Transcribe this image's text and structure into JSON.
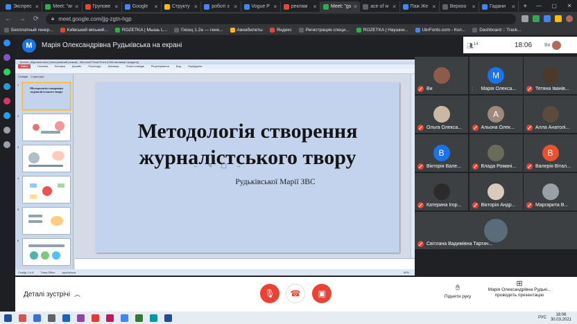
{
  "browser": {
    "tabs": [
      {
        "label": "Экспрес",
        "color": "#4285f4",
        "active": false
      },
      {
        "label": "Meet: \"ar",
        "color": "#34a853",
        "active": false
      },
      {
        "label": "Групове",
        "color": "#ea4335",
        "active": false
      },
      {
        "label": "Google",
        "color": "#4285f4",
        "active": false
      },
      {
        "label": "Структу",
        "color": "#fbbc04",
        "active": false
      },
      {
        "label": "роботі з",
        "color": "#4285f4",
        "active": false
      },
      {
        "label": "Vogue Р",
        "color": "#4285f4",
        "active": false
      },
      {
        "label": "реклам",
        "color": "#ea4335",
        "active": false
      },
      {
        "label": "Meet: \"gs",
        "color": "#34a853",
        "active": true
      },
      {
        "label": "ace of w",
        "color": "#5f6368",
        "active": false
      },
      {
        "label": "Паж Же",
        "color": "#4285f4",
        "active": false
      },
      {
        "label": "Верхоо",
        "color": "#5f6368",
        "active": false
      },
      {
        "label": "Гадани",
        "color": "#4285f4",
        "active": false
      }
    ],
    "url": "meet.google.com/jjg-zgtn-hgp",
    "bookmarks": [
      {
        "label": "Бесплатный генер...",
        "color": "#5f6368"
      },
      {
        "label": "Київський міський...",
        "color": "#ea4335"
      },
      {
        "label": "ROZETKA | Мышь L...",
        "color": "#34a853"
      },
      {
        "label": "Гисец 1.2а — гене...",
        "color": "#5f6368"
      },
      {
        "label": "Авиабилеты",
        "color": "#fbbc04"
      },
      {
        "label": "Яндекс",
        "color": "#ea4335"
      },
      {
        "label": "Регистрация специ...",
        "color": "#5f6368"
      },
      {
        "label": "ROZETKA | Наушни...",
        "color": "#34a853"
      },
      {
        "label": "UkrFonts.com - Кол...",
        "color": "#4285f4"
      },
      {
        "label": "Dashboard :: Track...",
        "color": "#5f6368"
      }
    ]
  },
  "meet": {
    "presenter_initial": "M",
    "presenter_title": "Марія Олександрівна Рудьківська на екрані",
    "participants_count": "14",
    "clock": "18:06",
    "me_label": "Ви",
    "details_label": "Деталі зустрічі",
    "raise_hand": "Підняти руку",
    "presenting": "Марія Олександрівна Рудькі... проводить презентацію"
  },
  "ppt": {
    "window_title": "Тренінг_Журналістика [Ілюстрований режим] - Microsoft PowerPoint (Сбій активації продукту)",
    "menu": [
      "Файл",
      "Головна",
      "Вставка",
      "Дизайн",
      "Переходи",
      "Анімація",
      "Показ слайдів",
      "Рецензування",
      "Вид",
      "Надбудова"
    ],
    "panel_tabs": [
      "Слайди",
      "Структура"
    ],
    "slide_title": "Методологія створення журналістського твору",
    "slide_subtitle": "Рудьківської Марії ЗВС",
    "thumb1_title": "Методологія створення журналістського твору",
    "status": [
      "Слайд 1 із 8",
      "Тема Office",
      "українська"
    ],
    "zoom": "80%",
    "thumb_numbers": [
      "1",
      "2",
      "3",
      "4",
      "5",
      "6"
    ]
  },
  "participants": [
    {
      "name": "Ви",
      "initial": "",
      "color": "#8d5b4c",
      "mic": "off"
    },
    {
      "name": "Марія Олекса...",
      "initial": "M",
      "color": "#1a73e8",
      "mic": "on"
    },
    {
      "name": "Тетяна Іванів...",
      "initial": "",
      "color": "#4b3a2a",
      "mic": "off"
    },
    {
      "name": "Ольга Олекса...",
      "initial": "",
      "color": "#c9b9a4",
      "mic": "off"
    },
    {
      "name": "Альона Олек...",
      "initial": "А",
      "color": "#a1887f",
      "mic": "off"
    },
    {
      "name": "Алла Анатолі...",
      "initial": "",
      "color": "#5c4b3b",
      "mic": "off"
    },
    {
      "name": "Вікторія Вале...",
      "initial": "В",
      "color": "#1a73e8",
      "mic": "off"
    },
    {
      "name": "Влада Романі...",
      "initial": "",
      "color": "#6b6b5a",
      "mic": "off"
    },
    {
      "name": "Валерія Вітал...",
      "initial": "В",
      "color": "#e8522f",
      "mic": "off"
    },
    {
      "name": "Катерина Ігор...",
      "initial": "",
      "color": "#2b2b2b",
      "mic": "off"
    },
    {
      "name": "Вікторія Андр...",
      "initial": "",
      "color": "#d9cbbb",
      "mic": "off"
    },
    {
      "name": "Маргарита В...",
      "initial": "",
      "color": "#9aa0a6",
      "mic": "off"
    },
    {
      "name": "Світлана Вадимівна Тартач...",
      "initial": "",
      "color": "#5a6b7a",
      "mic": "off"
    }
  ],
  "taskbar": {
    "apps": [
      "#d9534f",
      "#3b6fd8",
      "#5f6368",
      "#1565c0",
      "#8e44ad",
      "#e53935",
      "#c2185b",
      "#4285f4",
      "#2e7d32",
      "#0097a7",
      "#1e4e9a"
    ],
    "lang": "РУС",
    "time": "18:06",
    "date": "30.03.2021"
  }
}
